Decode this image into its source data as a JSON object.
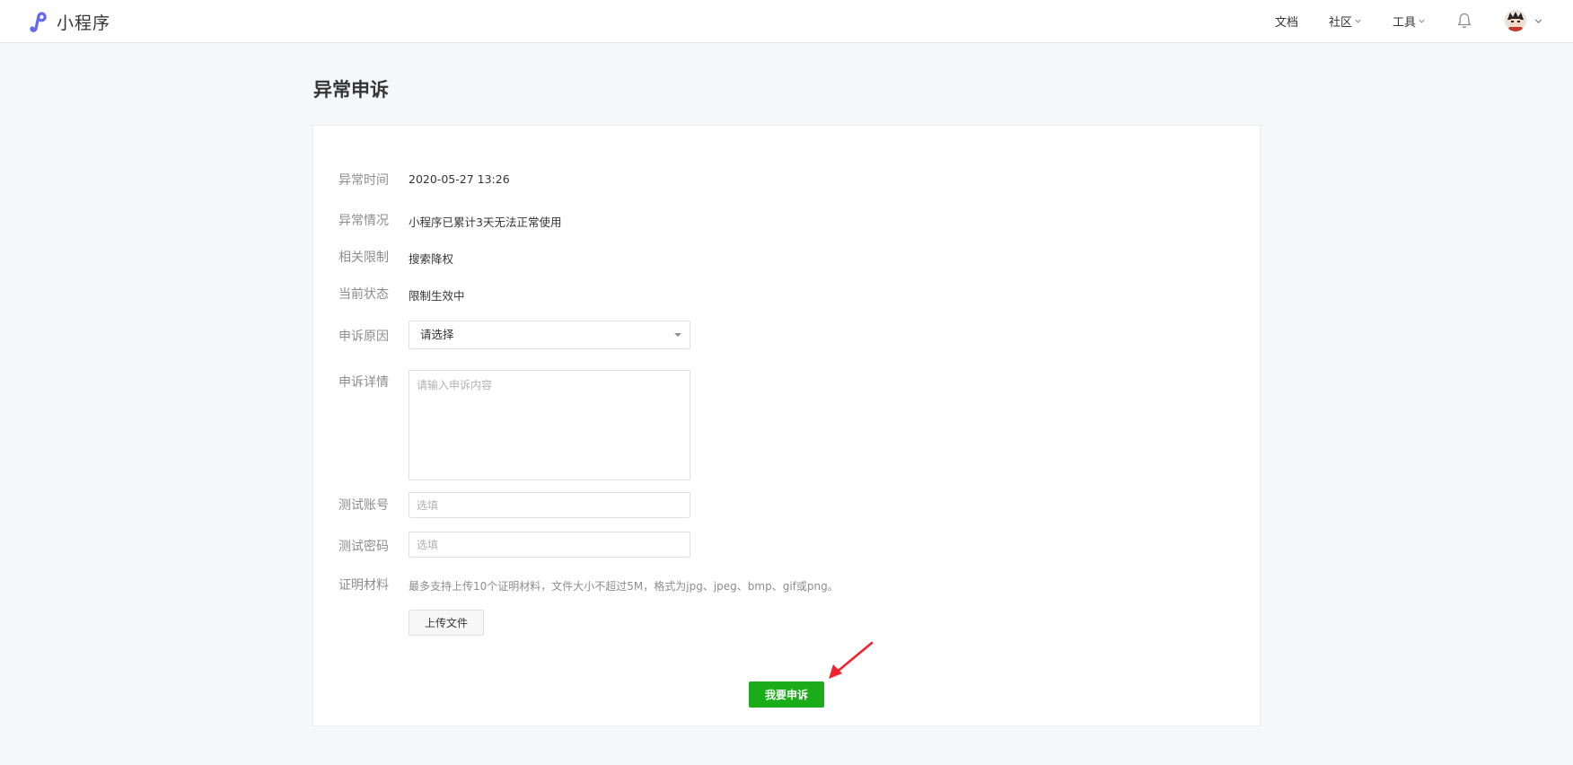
{
  "header": {
    "brand": "小程序",
    "nav": {
      "docs": "文档",
      "community": "社区",
      "tools": "工具"
    },
    "icons": [
      "logo-icon",
      "bell-icon",
      "avatar",
      "chevron-down-icon"
    ]
  },
  "page": {
    "title": "异常申诉"
  },
  "details": {
    "time_label": "异常时间",
    "time_value": "2020-05-27 13:26",
    "situation_label": "异常情况",
    "situation_value": "小程序已累计3天无法正常使用",
    "restriction_label": "相关限制",
    "restriction_value": "搜索降权",
    "status_label": "当前状态",
    "status_value": "限制生效中"
  },
  "form": {
    "reason_label": "申诉原因",
    "reason_selected": "请选择",
    "detail_label": "申诉详情",
    "detail_placeholder": "请输入申诉内容",
    "test_account_label": "测试账号",
    "test_account_placeholder": "选填",
    "test_password_label": "测试密码",
    "test_password_placeholder": "选填",
    "proof_label": "证明材料",
    "proof_hint": "最多支持上传10个证明材料，文件大小不超过5M，格式为jpg、jpeg、bmp、gif或png。",
    "upload_button": "上传文件",
    "submit_button": "我要申诉"
  },
  "colors": {
    "primary_green": "#1aad19",
    "annotation_red": "#f5222d",
    "page_bg": "#f6f7f9",
    "brand_purple": "#6467f0"
  }
}
